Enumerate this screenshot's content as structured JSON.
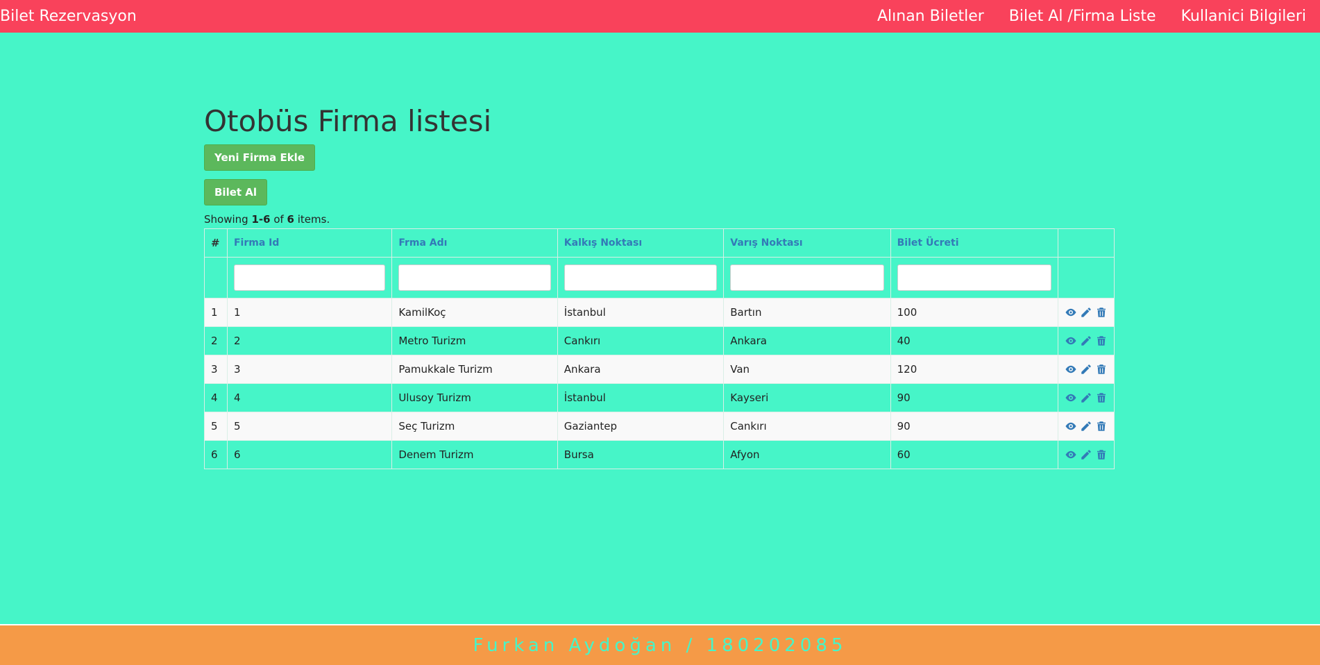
{
  "navbar": {
    "brand": "Bilet Rezervasyon",
    "links": [
      "Alınan Biletler",
      "Bilet Al /Firma Liste",
      "Kullanici Bilgileri"
    ]
  },
  "page": {
    "title": "Otobüs Firma listesi",
    "buttons": {
      "add_company": "Yeni Firma Ekle",
      "buy_ticket": "Bilet Al"
    },
    "summary": {
      "prefix": "Showing ",
      "range": "1-6",
      "mid": " of ",
      "total": "6",
      "suffix": " items."
    }
  },
  "table": {
    "headers": [
      "#",
      "Firma Id",
      "Frma Adı",
      "Kalkış Noktası",
      "Varış Noktası",
      "Bilet Ücreti"
    ],
    "rows": [
      [
        "1",
        "1",
        "KamilKoç",
        "İstanbul",
        "Bartın",
        "100"
      ],
      [
        "2",
        "2",
        "Metro Turizm",
        "Cankırı",
        "Ankara",
        "40"
      ],
      [
        "3",
        "3",
        "Pamukkale Turizm",
        "Ankara",
        "Van",
        "120"
      ],
      [
        "4",
        "4",
        "Ulusoy Turizm",
        "İstanbul",
        "Kayseri",
        "90"
      ],
      [
        "5",
        "5",
        "Seç Turizm",
        "Gaziantep",
        "Cankırı",
        "90"
      ],
      [
        "6",
        "6",
        "Denem Turizm",
        "Bursa",
        "Afyon",
        "60"
      ]
    ],
    "row_actions": [
      "eye-icon",
      "pencil-icon",
      "trash-icon"
    ]
  },
  "footer": {
    "text": "Furkan Aydoğan / 180202085"
  },
  "colors": {
    "navbar": "#f9425b",
    "background": "#46f5c8",
    "footer": "#f59a47",
    "button": "#5cb85c",
    "link": "#337ab7"
  }
}
